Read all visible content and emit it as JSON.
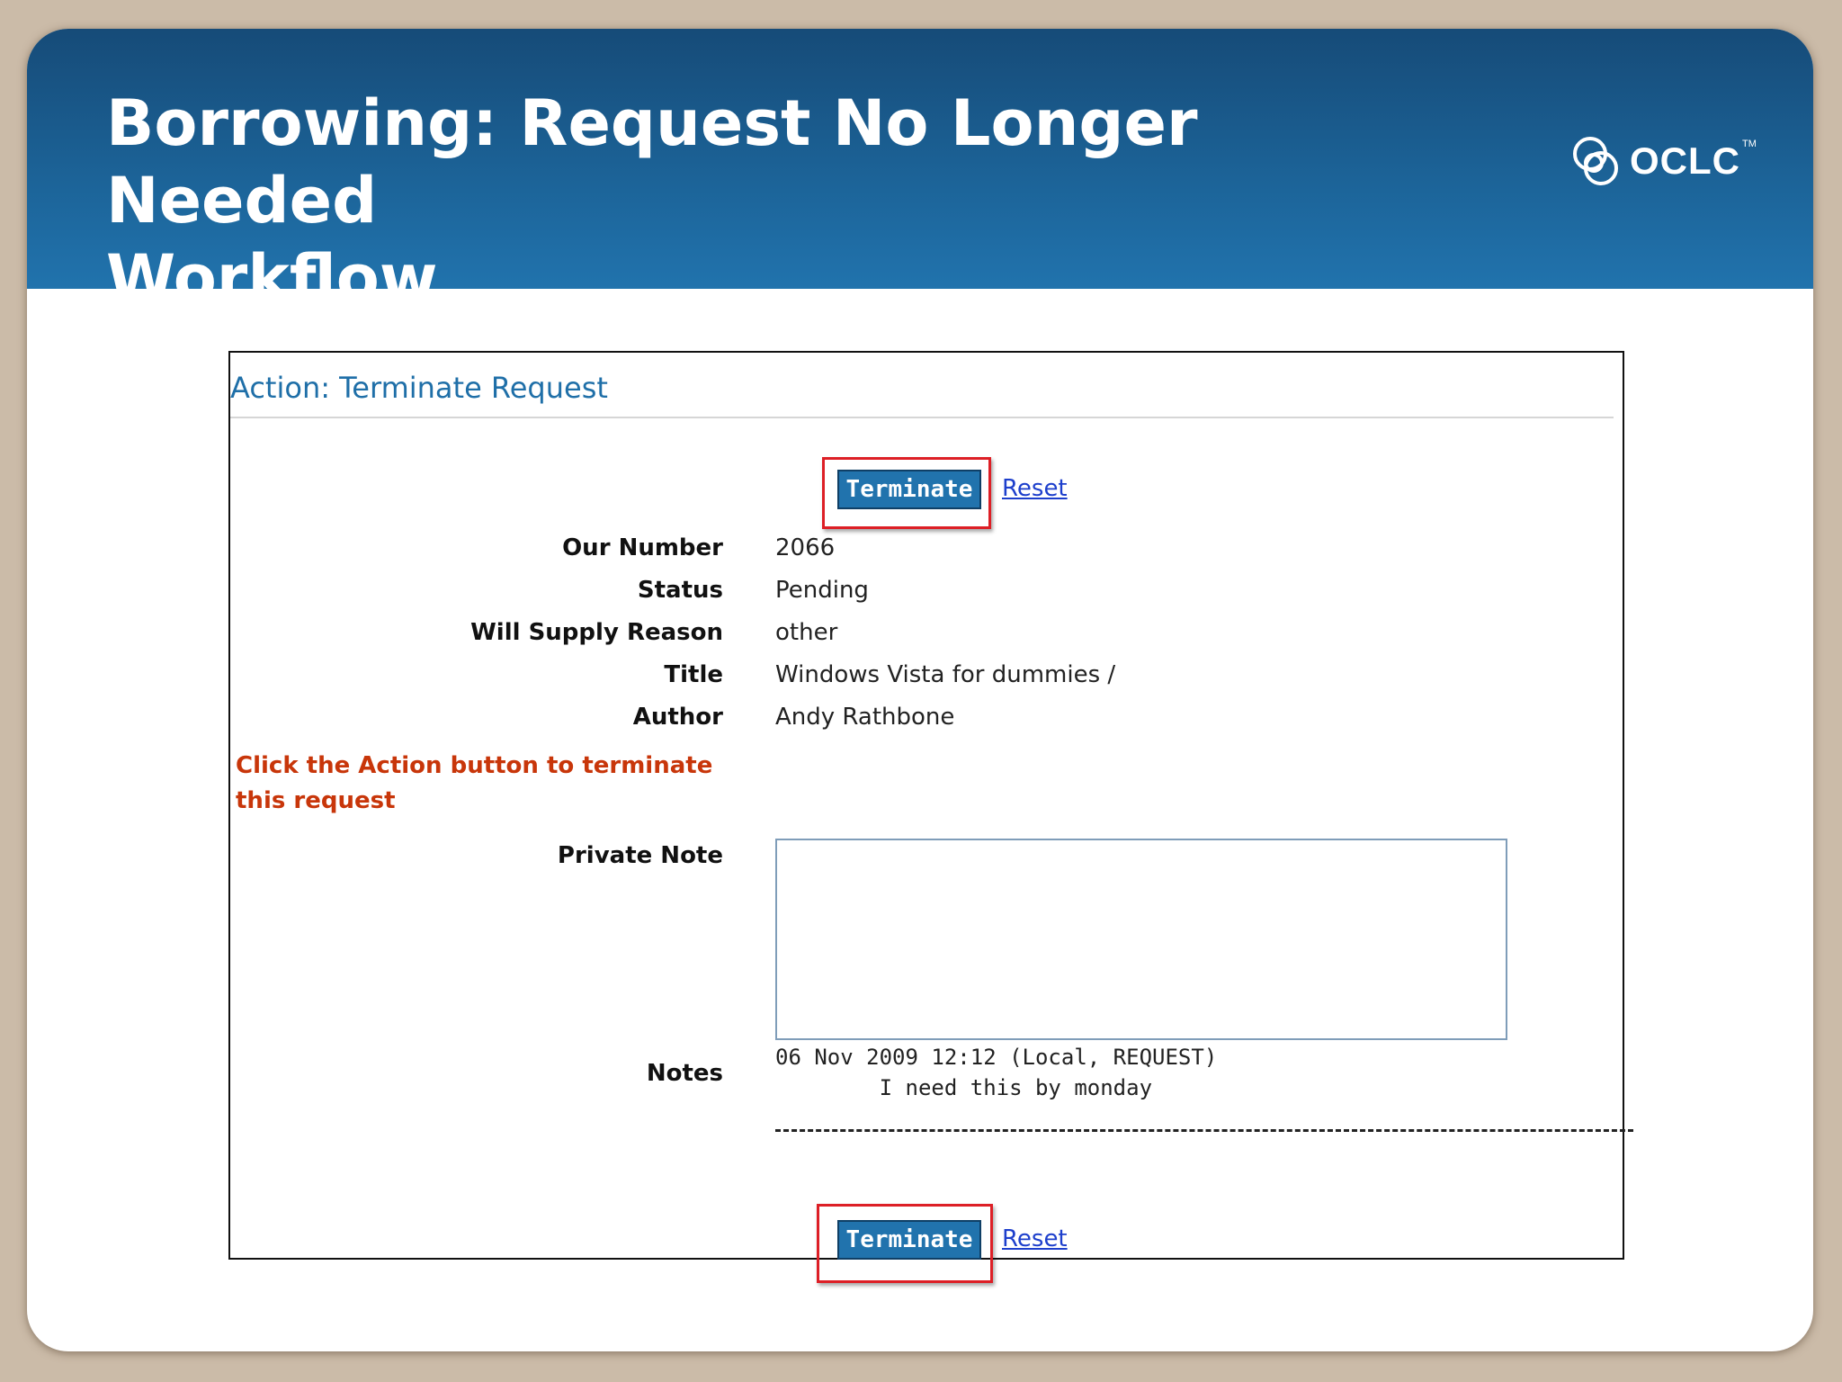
{
  "slide": {
    "title_line1": "Borrowing: Request No Longer Needed",
    "title_line2": "Workflow",
    "logo_text": "OCLC",
    "logo_tm": "TM"
  },
  "form": {
    "heading": "Action: Terminate Request",
    "terminate_label": "Terminate",
    "reset_label": "Reset",
    "fields": [
      {
        "label": "Our Number",
        "value": "2066"
      },
      {
        "label": "Status",
        "value": "Pending"
      },
      {
        "label": "Will Supply Reason",
        "value": "other"
      },
      {
        "label": "Title",
        "value": "Windows Vista for dummies /"
      },
      {
        "label": "Author",
        "value": "Andy Rathbone"
      }
    ],
    "instruction_line1": "Click the Action button to terminate",
    "instruction_line2": "this request",
    "private_note_label": "Private Note",
    "private_note_value": "",
    "notes_label": "Notes",
    "notes_line1": "06 Nov 2009 12:12 (Local, REQUEST)",
    "notes_line2": "        I need this by monday"
  },
  "colors": {
    "banner": "#1c6499",
    "button": "#2173ad",
    "highlight": "#dd1f26",
    "instruction": "#c8360a",
    "heading": "#1f6fa8"
  },
  "icons": {
    "logo": "oclc-logo-icon"
  }
}
